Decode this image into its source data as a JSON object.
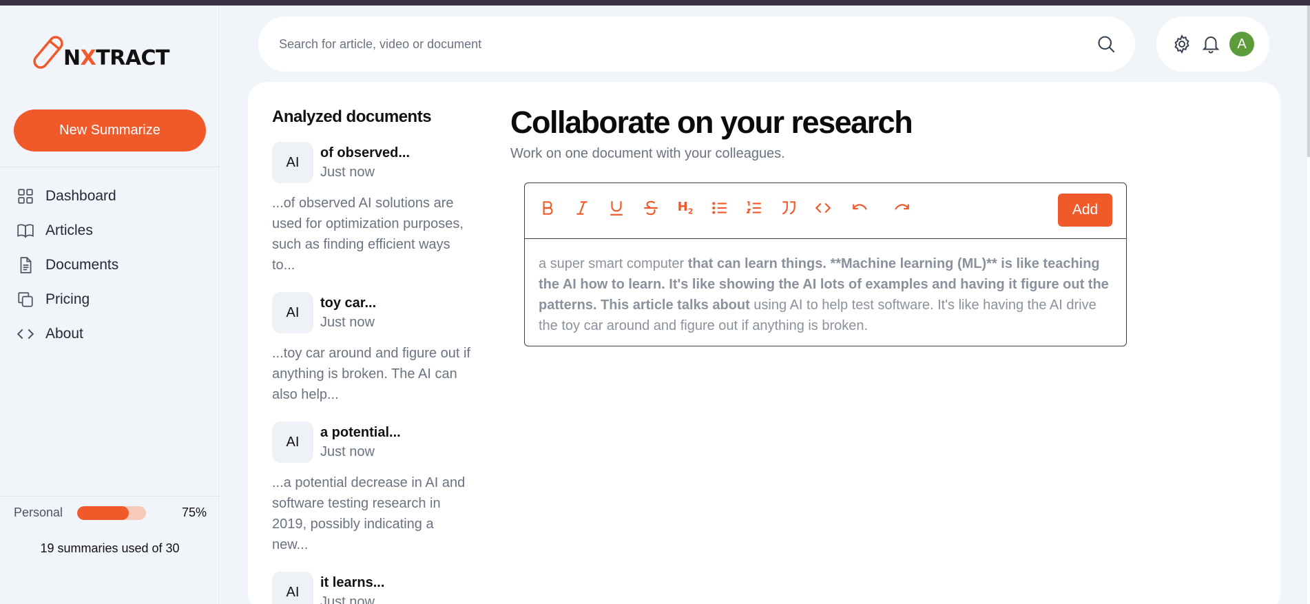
{
  "brand": {
    "logo_prefix": "N",
    "logo_x": "X",
    "logo_suffix": "TRACT"
  },
  "sidebar": {
    "new_button": "New Summarize",
    "items": [
      {
        "label": "Dashboard",
        "icon": "grid-icon"
      },
      {
        "label": "Articles",
        "icon": "book-icon"
      },
      {
        "label": "Documents",
        "icon": "document-icon"
      },
      {
        "label": "Pricing",
        "icon": "copy-icon"
      },
      {
        "label": "About",
        "icon": "code-icon"
      }
    ],
    "plan": {
      "label": "Personal",
      "percent_text": "75%",
      "percent": 75
    },
    "usage": "19 summaries used of 30"
  },
  "search": {
    "placeholder": "Search for article, video or document"
  },
  "docs": {
    "heading": "Analyzed documents",
    "items": [
      {
        "badge": "AI",
        "title": "of observed...",
        "time": "Just now",
        "snippet": "...of observed AI solutions are used for optimization purposes, such as finding efficient ways to..."
      },
      {
        "badge": "AI",
        "title": "toy car...",
        "time": "Just now",
        "snippet": "...toy car around and figure out if anything is broken. The AI can also help..."
      },
      {
        "badge": "AI",
        "title": "a potential...",
        "time": "Just now",
        "snippet": "...a potential decrease in AI and software testing research in 2019, possibly indicating a new..."
      },
      {
        "badge": "AI",
        "title": "it learns...",
        "time": "Just now",
        "snippet": ""
      }
    ]
  },
  "editor": {
    "title": "Collaborate on your research",
    "subtitle": "Work on one document with your colleagues.",
    "add_button": "Add",
    "content": {
      "part1": "a super smart computer ",
      "bold": "that can learn things. **Machine learning (ML)** is like teaching the AI how to learn. It's like showing the AI lots of examples and having it figure out the patterns. This article talks about",
      "part2": " using AI to help test software. It's like having the AI drive the toy car around and figure out if anything is broken."
    }
  },
  "user": {
    "initial": "A"
  },
  "colors": {
    "accent": "#f0592a",
    "avatar": "#5c9c3a",
    "background": "#f1f4f8"
  }
}
